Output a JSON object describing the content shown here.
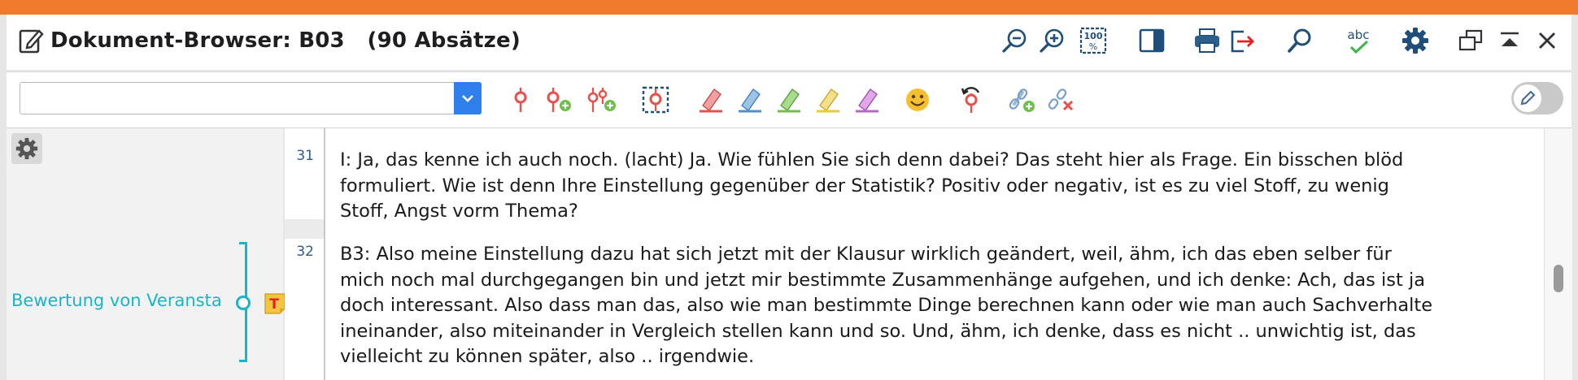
{
  "window": {
    "title": "Dokument-Browser: B03   (90 Absätze)"
  },
  "colors": {
    "accent_bar": "#f07a2e",
    "code_color": "#19b5c7",
    "combo_button": "#2f80ed",
    "memo_badge": "#f5c542",
    "memo_letter": "#e02020"
  },
  "title_icons": [
    "zoom-out-icon",
    "zoom-in-icon",
    "zoom-100-icon",
    "panel-toggle-icon",
    "print-icon",
    "export-icon",
    "search-icon",
    "spellcheck-icon",
    "settings-icon",
    "restore-window-icon",
    "collapse-icon",
    "close-icon"
  ],
  "zoom100_label": "100",
  "spellcheck_label": "abc",
  "combo": {
    "value": ""
  },
  "toolbar_icons": [
    "code-icon",
    "code-add-icon",
    "code-in-vivo-icon",
    "code-selection-icon",
    "highlight-red-icon",
    "highlight-blue-icon",
    "highlight-green-icon",
    "highlight-yellow-icon",
    "highlight-purple-icon",
    "emoticon-icon",
    "undo-code-icon",
    "link-add-icon",
    "link-remove-icon"
  ],
  "edit_toggle": {
    "state": "off"
  },
  "left_pane": {
    "code_label": "Bewertung von Veransta",
    "memo_letter": "T"
  },
  "paragraphs": [
    {
      "number": "31",
      "lines": [
        "I: Ja, das kenne ich auch noch. (lacht) Ja. Wie fühlen Sie sich denn dabei? Das steht hier als Frage. Ein bisschen blöd",
        "formuliert. Wie ist denn Ihre Einstellung gegenüber der Statistik? Positiv oder negativ, ist es zu viel Stoff, zu wenig",
        "Stoff, Angst vorm Thema?"
      ]
    },
    {
      "number": "32",
      "lines": [
        "B3: Also meine Einstellung dazu hat sich jetzt mit der Klausur wirklich geändert, weil, ähm, ich das eben selber für",
        "mich noch mal durchgegangen bin und jetzt mir bestimmte Zusammenhänge aufgehen, und ich denke: Ach, das ist ja",
        "doch interessant. Also dass man das, also wie man bestimmte Dinge berechnen kann oder wie man auch Sachverhalte",
        "ineinander, also miteinander in Vergleich stellen kann und so. Und, ähm, ich denke, dass es nicht .. unwichtig ist, das",
        "vielleicht zu können später, also .. irgendwie."
      ]
    }
  ]
}
